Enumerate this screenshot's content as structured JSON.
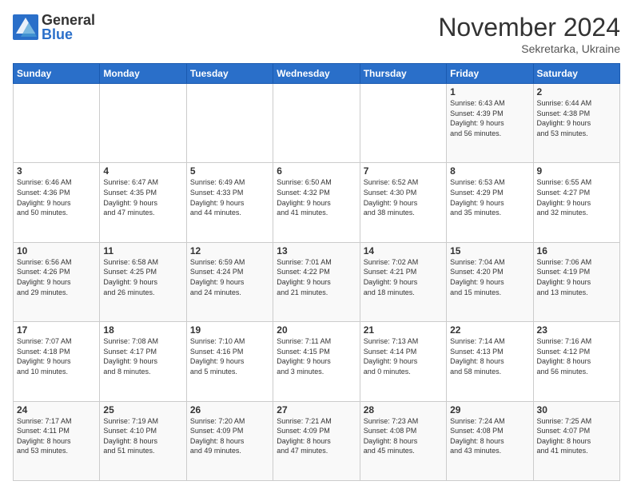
{
  "logo": {
    "general": "General",
    "blue": "Blue"
  },
  "header": {
    "month": "November 2024",
    "location": "Sekretarka, Ukraine"
  },
  "weekdays": [
    "Sunday",
    "Monday",
    "Tuesday",
    "Wednesday",
    "Thursday",
    "Friday",
    "Saturday"
  ],
  "weeks": [
    [
      {
        "day": "",
        "info": ""
      },
      {
        "day": "",
        "info": ""
      },
      {
        "day": "",
        "info": ""
      },
      {
        "day": "",
        "info": ""
      },
      {
        "day": "",
        "info": ""
      },
      {
        "day": "1",
        "info": "Sunrise: 6:43 AM\nSunset: 4:39 PM\nDaylight: 9 hours\nand 56 minutes."
      },
      {
        "day": "2",
        "info": "Sunrise: 6:44 AM\nSunset: 4:38 PM\nDaylight: 9 hours\nand 53 minutes."
      }
    ],
    [
      {
        "day": "3",
        "info": "Sunrise: 6:46 AM\nSunset: 4:36 PM\nDaylight: 9 hours\nand 50 minutes."
      },
      {
        "day": "4",
        "info": "Sunrise: 6:47 AM\nSunset: 4:35 PM\nDaylight: 9 hours\nand 47 minutes."
      },
      {
        "day": "5",
        "info": "Sunrise: 6:49 AM\nSunset: 4:33 PM\nDaylight: 9 hours\nand 44 minutes."
      },
      {
        "day": "6",
        "info": "Sunrise: 6:50 AM\nSunset: 4:32 PM\nDaylight: 9 hours\nand 41 minutes."
      },
      {
        "day": "7",
        "info": "Sunrise: 6:52 AM\nSunset: 4:30 PM\nDaylight: 9 hours\nand 38 minutes."
      },
      {
        "day": "8",
        "info": "Sunrise: 6:53 AM\nSunset: 4:29 PM\nDaylight: 9 hours\nand 35 minutes."
      },
      {
        "day": "9",
        "info": "Sunrise: 6:55 AM\nSunset: 4:27 PM\nDaylight: 9 hours\nand 32 minutes."
      }
    ],
    [
      {
        "day": "10",
        "info": "Sunrise: 6:56 AM\nSunset: 4:26 PM\nDaylight: 9 hours\nand 29 minutes."
      },
      {
        "day": "11",
        "info": "Sunrise: 6:58 AM\nSunset: 4:25 PM\nDaylight: 9 hours\nand 26 minutes."
      },
      {
        "day": "12",
        "info": "Sunrise: 6:59 AM\nSunset: 4:24 PM\nDaylight: 9 hours\nand 24 minutes."
      },
      {
        "day": "13",
        "info": "Sunrise: 7:01 AM\nSunset: 4:22 PM\nDaylight: 9 hours\nand 21 minutes."
      },
      {
        "day": "14",
        "info": "Sunrise: 7:02 AM\nSunset: 4:21 PM\nDaylight: 9 hours\nand 18 minutes."
      },
      {
        "day": "15",
        "info": "Sunrise: 7:04 AM\nSunset: 4:20 PM\nDaylight: 9 hours\nand 15 minutes."
      },
      {
        "day": "16",
        "info": "Sunrise: 7:06 AM\nSunset: 4:19 PM\nDaylight: 9 hours\nand 13 minutes."
      }
    ],
    [
      {
        "day": "17",
        "info": "Sunrise: 7:07 AM\nSunset: 4:18 PM\nDaylight: 9 hours\nand 10 minutes."
      },
      {
        "day": "18",
        "info": "Sunrise: 7:08 AM\nSunset: 4:17 PM\nDaylight: 9 hours\nand 8 minutes."
      },
      {
        "day": "19",
        "info": "Sunrise: 7:10 AM\nSunset: 4:16 PM\nDaylight: 9 hours\nand 5 minutes."
      },
      {
        "day": "20",
        "info": "Sunrise: 7:11 AM\nSunset: 4:15 PM\nDaylight: 9 hours\nand 3 minutes."
      },
      {
        "day": "21",
        "info": "Sunrise: 7:13 AM\nSunset: 4:14 PM\nDaylight: 9 hours\nand 0 minutes."
      },
      {
        "day": "22",
        "info": "Sunrise: 7:14 AM\nSunset: 4:13 PM\nDaylight: 8 hours\nand 58 minutes."
      },
      {
        "day": "23",
        "info": "Sunrise: 7:16 AM\nSunset: 4:12 PM\nDaylight: 8 hours\nand 56 minutes."
      }
    ],
    [
      {
        "day": "24",
        "info": "Sunrise: 7:17 AM\nSunset: 4:11 PM\nDaylight: 8 hours\nand 53 minutes."
      },
      {
        "day": "25",
        "info": "Sunrise: 7:19 AM\nSunset: 4:10 PM\nDaylight: 8 hours\nand 51 minutes."
      },
      {
        "day": "26",
        "info": "Sunrise: 7:20 AM\nSunset: 4:09 PM\nDaylight: 8 hours\nand 49 minutes."
      },
      {
        "day": "27",
        "info": "Sunrise: 7:21 AM\nSunset: 4:09 PM\nDaylight: 8 hours\nand 47 minutes."
      },
      {
        "day": "28",
        "info": "Sunrise: 7:23 AM\nSunset: 4:08 PM\nDaylight: 8 hours\nand 45 minutes."
      },
      {
        "day": "29",
        "info": "Sunrise: 7:24 AM\nSunset: 4:08 PM\nDaylight: 8 hours\nand 43 minutes."
      },
      {
        "day": "30",
        "info": "Sunrise: 7:25 AM\nSunset: 4:07 PM\nDaylight: 8 hours\nand 41 minutes."
      }
    ]
  ]
}
